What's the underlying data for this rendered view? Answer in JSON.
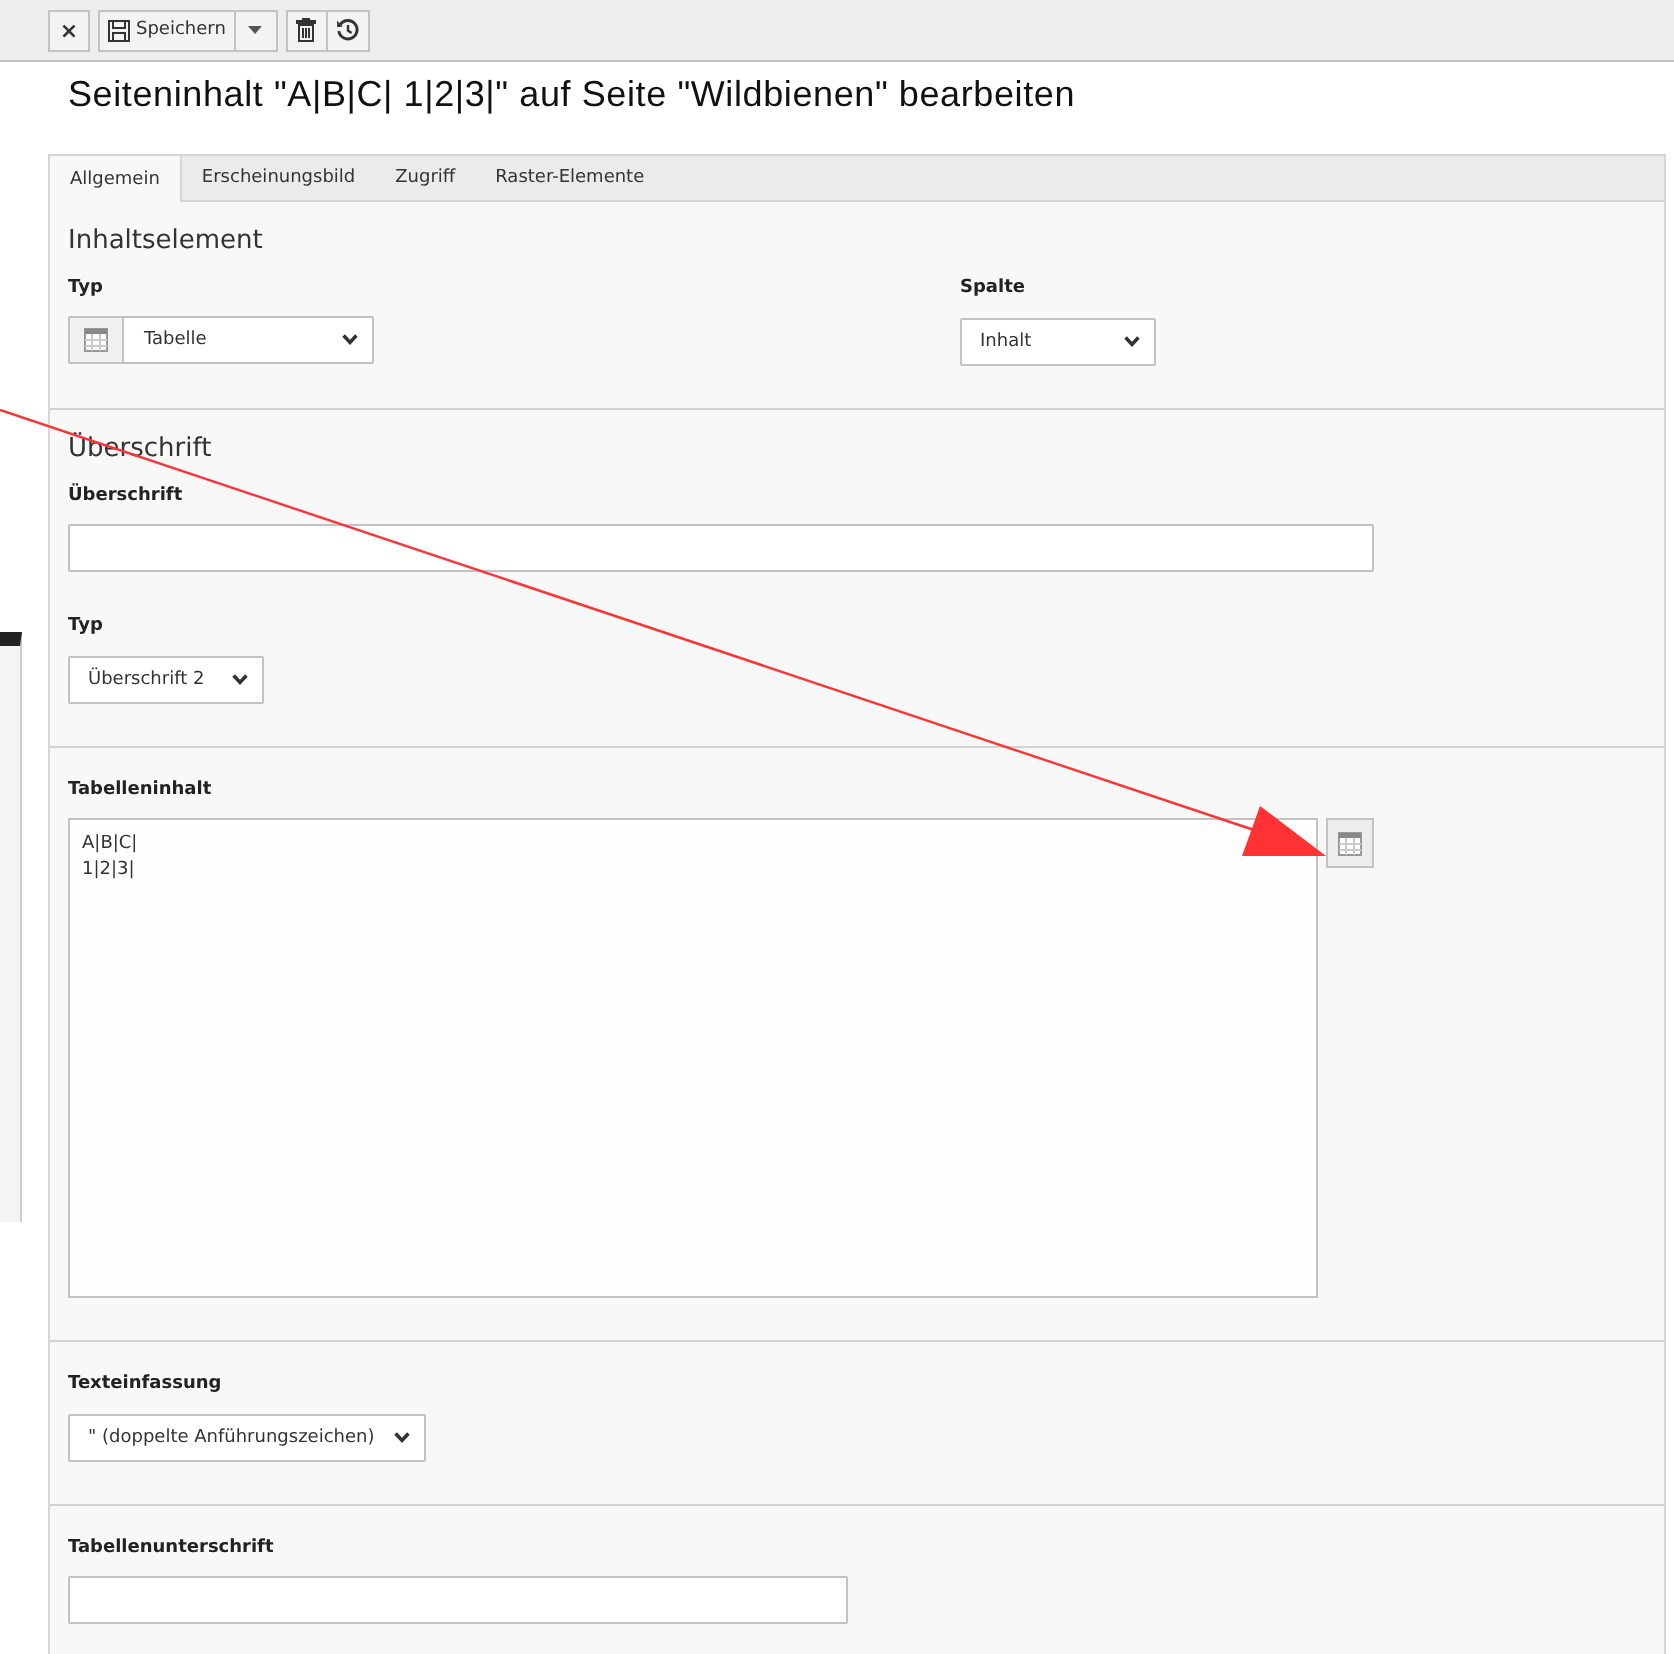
{
  "toolbar": {
    "groups": [
      [
        {
          "kind": "close",
          "label": "×"
        }
      ],
      [
        {
          "kind": "save",
          "label": "Speichern"
        },
        {
          "kind": "dropdown"
        }
      ],
      [
        {
          "kind": "delete"
        },
        {
          "kind": "history"
        }
      ]
    ]
  },
  "title": "Seiteninhalt \"A|B|C| 1|2|3|\" auf Seite \"Wildbienen\" bearbeiten",
  "tabs": [
    {
      "label": "Allgemein",
      "selected": true
    },
    {
      "label": "Erscheinungsbild",
      "selected": false
    },
    {
      "label": "Zugriff",
      "selected": false
    },
    {
      "label": "Raster-Elemente",
      "selected": false
    }
  ],
  "sections": [
    {
      "title": "Inhaltselement",
      "rows": [
        [
          {
            "label": "Typ",
            "kind": "select-icon",
            "value": "Tabelle"
          },
          {
            "label": "Spalte",
            "kind": "select",
            "value": "Inhalt"
          }
        ]
      ]
    },
    {
      "title": "Überschrift",
      "rows": [
        [
          {
            "label": "Überschrift",
            "kind": "input"
          }
        ],
        [
          {
            "label": "Typ",
            "kind": "select",
            "value": "Überschrift 2"
          }
        ]
      ]
    },
    {
      "rows": [
        [
          {
            "label": "Tabelleninhalt",
            "kind": "textarea",
            "value": "A|B|C|\n1|2|3|",
            "wizard_button": true
          }
        ]
      ]
    },
    {
      "rows": [
        [
          {
            "label": "Texteinfassung",
            "kind": "select",
            "value": "\" (doppelte Anführungszeichen)"
          }
        ]
      ]
    },
    {
      "rows": [
        [
          {
            "label": "Tabellenunterschrift",
            "kind": "input"
          }
        ]
      ]
    }
  ],
  "annotations": [
    {
      "kind": "arrow"
    }
  ]
}
